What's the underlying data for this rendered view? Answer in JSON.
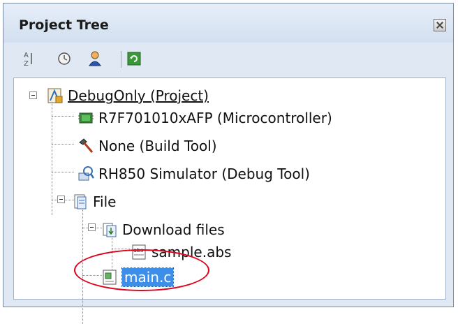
{
  "panel": {
    "title": "Project Tree"
  },
  "toolbar": {
    "icons": [
      "sort-icon",
      "clock-icon",
      "user-icon",
      "refresh-icon"
    ]
  },
  "tree": {
    "project": "DebugOnly (Project)",
    "microcontroller": "R7F701010xAFP (Microcontroller)",
    "build_tool": "None (Build Tool)",
    "debug_tool": "RH850 Simulator (Debug Tool)",
    "file_folder": "File",
    "download_folder": "Download files",
    "download_file": "sample.abs",
    "selected_file": "main.c"
  },
  "colors": {
    "selection": "#3d8ee8",
    "highlight": "#e0001b"
  }
}
